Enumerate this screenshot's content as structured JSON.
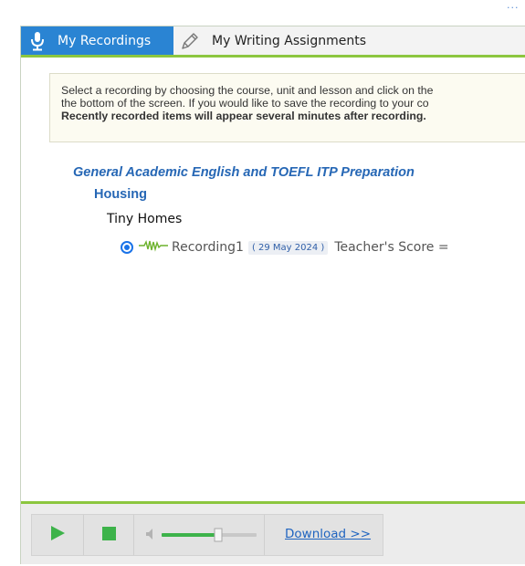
{
  "tabs": {
    "recordings_label": "My Recordings",
    "writing_label": "My Writing Assignments"
  },
  "info": {
    "line1": "Select a recording by choosing the course, unit and lesson and click on the",
    "line2": "the bottom of the screen. If you would like to save the recording to your co",
    "line3": "Recently recorded items will appear several minutes after recording."
  },
  "tree": {
    "course": "General Academic English and TOEFL ITP Preparation",
    "unit": "Housing",
    "lesson": "Tiny Homes",
    "recording": {
      "name": "Recording1",
      "date": "( 29 May 2024 )",
      "score_label": "Teacher's Score ="
    }
  },
  "player": {
    "download_label": "Download >>",
    "volume": 0.6
  },
  "colors": {
    "tab_active_bg": "#2a84d3",
    "accent_green": "#8cc63f",
    "link_blue": "#1f64c0",
    "heading_blue": "#2667b5"
  },
  "icons": {
    "recordings_tab": "microphone-icon",
    "writing_tab": "pencil-icon",
    "waveform": "waveform-icon",
    "play": "play-icon",
    "stop": "stop-icon",
    "volume": "speaker-icon"
  }
}
